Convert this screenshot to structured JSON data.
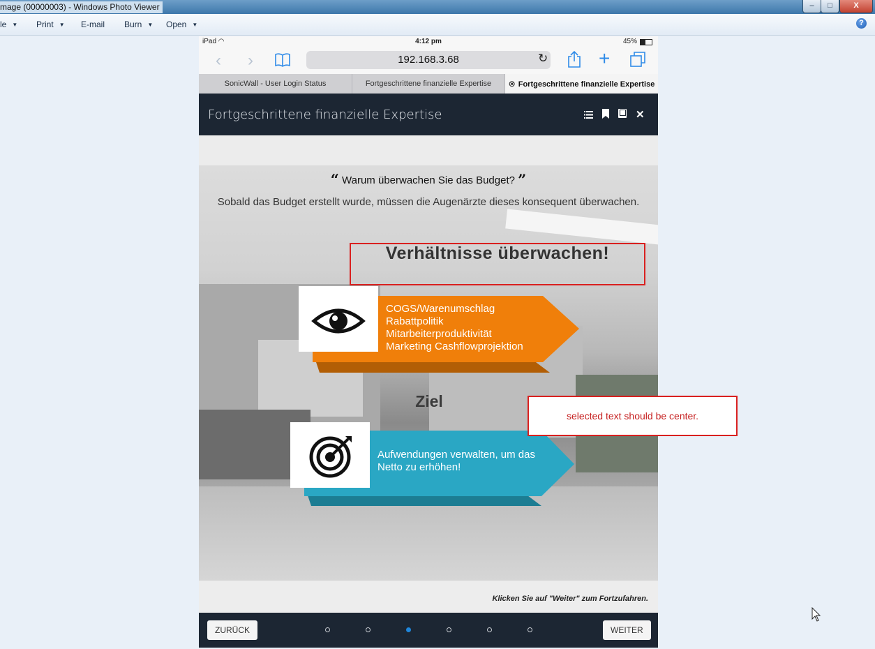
{
  "window": {
    "title": "mage (00000003) - Windows Photo Viewer",
    "bg_tab_1": "",
    "bg_tab_2": "",
    "controls": {
      "minimize": "–",
      "maximize": "□",
      "close": "X"
    }
  },
  "menubar": {
    "items": [
      {
        "label": "le",
        "has_arrow": true
      },
      {
        "label": "Print",
        "has_arrow": true
      },
      {
        "label": "E-mail",
        "has_arrow": false
      },
      {
        "label": "Burn",
        "has_arrow": true
      },
      {
        "label": "Open",
        "has_arrow": true
      }
    ],
    "help": "?"
  },
  "ipad": {
    "status": {
      "device": "iPad",
      "time": "4:12 pm",
      "battery": "45%"
    },
    "url": "192.168.3.68",
    "tabs": [
      {
        "label": "SonicWall - User Login Status",
        "active": false
      },
      {
        "label": "Fortgeschrittene finanzielle Expertise",
        "active": false
      },
      {
        "label": "Fortgeschrittene finanzielle Expertise",
        "active": true
      }
    ],
    "app_title": "Fortgeschrittene finanzielle Expertise",
    "header_icons": [
      "list-icon",
      "bookmark-icon",
      "book-icon",
      "close-icon"
    ],
    "slide": {
      "quote_open": "“",
      "question": "Warum überwachen Sie das Budget?",
      "quote_close": "”",
      "subtitle": "Sobald das Budget erstellt wurde, müssen die Augenärzte dieses konsequent überwachen.",
      "heading": "Verhältnisse überwachen!",
      "card1": {
        "icon": "eye-icon",
        "color": "#f07f0a",
        "lines": [
          "COGS/Warenumschlag",
          "Rabattpolitik",
          "Mitarbeiterproduktivität",
          "Marketing Cashflowprojektion"
        ]
      },
      "ziel": "Ziel",
      "card2": {
        "icon": "target-icon",
        "color": "#2aa7c4",
        "lines": [
          "Aufwendungen verwalten, um das",
          "Netto zu erhöhen!"
        ]
      }
    },
    "hint": "Klicken Sie auf \"Weiter\" zum Fortzufahren.",
    "nav": {
      "back": "ZURÜCK",
      "next": "WEITER",
      "dot_count": 6,
      "active_dot": 3
    }
  },
  "annotation": {
    "note": "selected text should be center.",
    "color": "#d9201f"
  }
}
